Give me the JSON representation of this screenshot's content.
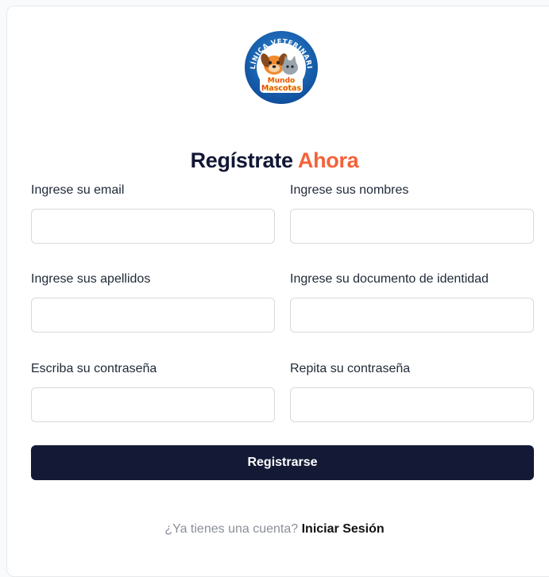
{
  "logo": {
    "ring_text": "CLÍNICA VETERINARIA",
    "brand_line1": "Mundo",
    "brand_line2": "Mascotas",
    "ring_color": "#1a62b4",
    "brand_color": "#e3322b"
  },
  "header": {
    "title_main": "Regístrate",
    "title_accent": "Ahora",
    "accent_color": "#f4623a"
  },
  "form": {
    "email": {
      "label": "Ingrese su email",
      "value": ""
    },
    "names": {
      "label": "Ingrese sus nombres",
      "value": ""
    },
    "surnames": {
      "label": "Ingrese sus apellidos",
      "value": ""
    },
    "document": {
      "label": "Ingrese su documento de identidad",
      "value": ""
    },
    "password": {
      "label": "Escriba su contraseña",
      "value": ""
    },
    "password_repeat": {
      "label": "Repita su contraseña",
      "value": ""
    },
    "submit_label": "Registrarse",
    "submit_color": "#141a36"
  },
  "footer": {
    "question": "¿Ya tienes una cuenta?",
    "login_link": "Iniciar Sesión"
  }
}
